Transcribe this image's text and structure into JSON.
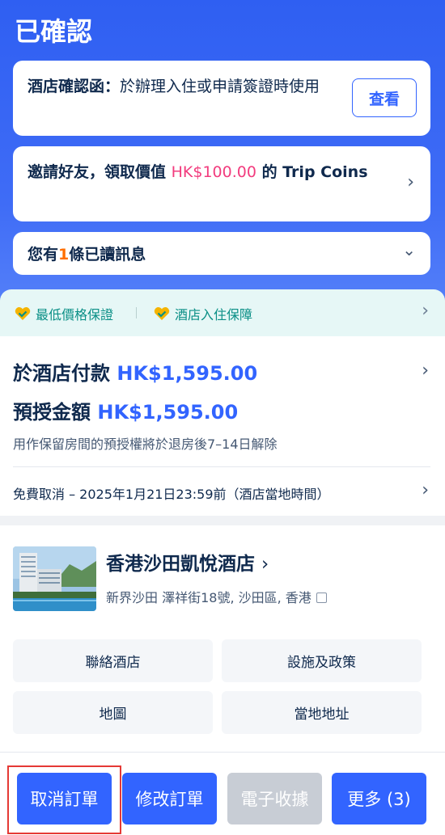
{
  "status_title": "已確認",
  "confirmation_card": {
    "label": "酒店確認函：",
    "text": "於辦理入住或申請簽證時使用",
    "view_button": "查看"
  },
  "invite_card": {
    "prefix": "邀請好友，領取價值 ",
    "amount": "HK$100.00",
    "suffix": " 的 Trip Coins"
  },
  "messages_card": {
    "prefix": "您有",
    "count": "1",
    "suffix": "條已讀訊息"
  },
  "guarantees": {
    "item1": "最低價格保證",
    "item2": "酒店入住保障",
    "icon_color": "#f5b400",
    "text_color": "#0a8f86"
  },
  "payment": {
    "pay_label": "於酒店付款 ",
    "pay_amount": "HK$1,595.00",
    "preauth_label": "預授金額 ",
    "preauth_amount": "HK$1,595.00",
    "note": "用作保留房間的預授權將於退房後7–14日解除",
    "cancel_policy": "免費取消 – 2025年1月21日23:59前（酒店當地時間）"
  },
  "hotel": {
    "name": "香港沙田凱悅酒店",
    "address": "新界沙田 澤祥街18號, 沙田區, 香港"
  },
  "options": {
    "contact": "聯絡酒店",
    "facilities": "設施及政策",
    "map": "地圖",
    "local_address": "當地地址"
  },
  "bottom_bar": {
    "cancel": "取消訂單",
    "modify": "修改訂單",
    "receipt": "電子收據",
    "more": "更多 (3)"
  },
  "colors": {
    "primary": "#3264ff",
    "highlight_box": "#e53935",
    "pink_amount": "#f23c7e",
    "orange_count": "#ff6f00"
  }
}
